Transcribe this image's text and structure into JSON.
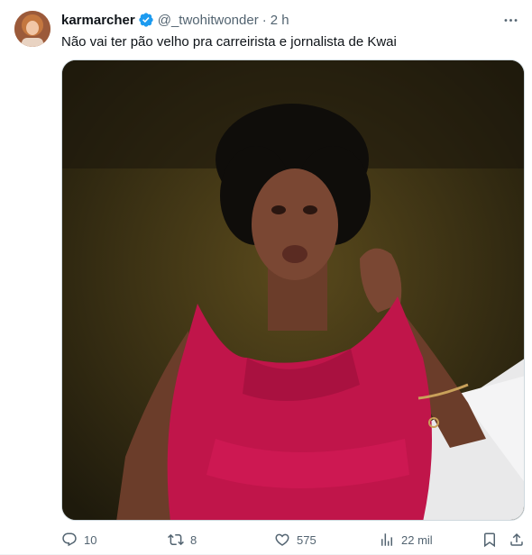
{
  "tweet": {
    "author": {
      "name": "karmarcher",
      "handle": "@_twohitwonder",
      "separator": "·",
      "time": "2 h"
    },
    "text": "Não vai ter pão velho pra carreirista e jornalista de Kwai",
    "media": {
      "kind": "image",
      "description_icon": "photo"
    },
    "actions": {
      "replies": "10",
      "reposts": "8",
      "likes": "575",
      "views": "22 mil"
    }
  },
  "colors": {
    "text_primary": "#0f1419",
    "text_secondary": "#536471",
    "verified_blue": "#1d9bf0",
    "border": "#cfd9de"
  },
  "icons": [
    "more-icon",
    "verified-icon",
    "reply-icon",
    "repost-icon",
    "like-icon",
    "views-icon",
    "bookmark-icon",
    "share-icon"
  ]
}
